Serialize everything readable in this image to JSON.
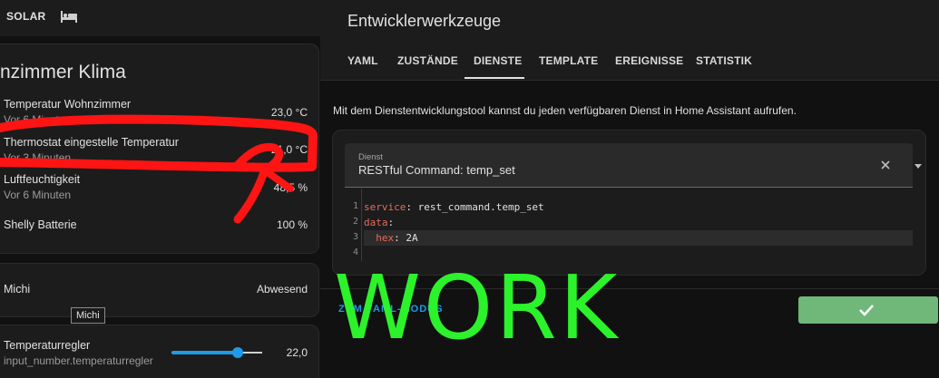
{
  "dashboard": {
    "view_tab": "SOLAR",
    "view_icon": "bed-icon",
    "climate_card": {
      "title": "nzimmer Klima",
      "rows": [
        {
          "name": "Temperatur Wohnzimmer",
          "sub": "Vor 6 Minuten",
          "value": "23,0 °C"
        },
        {
          "name": "Thermostat eingestelle Temperatur",
          "sub": "Vor 3 Minuten",
          "value": "21,0 °C"
        },
        {
          "name": "Luftfeuchtigkeit",
          "sub": "Vor 6 Minuten",
          "value": "48,5 %"
        },
        {
          "name": "Shelly Batterie",
          "value": "100 %"
        }
      ]
    },
    "person_card": {
      "name": "Michi",
      "state": "Abwesend",
      "tooltip": "Michi"
    },
    "regler_card": {
      "name": "Temperaturregler",
      "entity": "input_number.temperaturregler",
      "value": "22,0",
      "slider_fraction": 0.73
    }
  },
  "devtools": {
    "title": "Entwicklerwerkzeuge",
    "tabs": [
      "YAML",
      "ZUSTÄNDE",
      "DIENSTE",
      "TEMPLATE",
      "EREIGNISSE",
      "STATISTIK"
    ],
    "active_tab": "DIENSTE",
    "description": "Mit dem Dienstentwicklungstool kannst du jeden verfügbaren Dienst in Home Assistant aufrufen.",
    "service_select": {
      "label": "Dienst",
      "value": "RESTful Command: temp_set"
    },
    "editor": {
      "line_numbers": [
        "1",
        "2",
        "3",
        "4"
      ],
      "lines": [
        {
          "key": "service",
          "value": " rest_command.temp_set"
        },
        {
          "key": "data",
          "value": ""
        },
        {
          "key": "  hex",
          "value": " 2A"
        },
        {
          "key": "",
          "value": ""
        }
      ],
      "active_line": 3
    },
    "link_button": "ZUM YAML-MODUS",
    "call_button_icon": "check-icon"
  },
  "overlay_text": "WORK",
  "colors": {
    "accent_blue": "#1e9be8",
    "call_button_green": "#6fb879",
    "overlay_green": "#2cf22c",
    "scribble_red": "#ff1414",
    "yaml_key": "#e56b5b"
  }
}
